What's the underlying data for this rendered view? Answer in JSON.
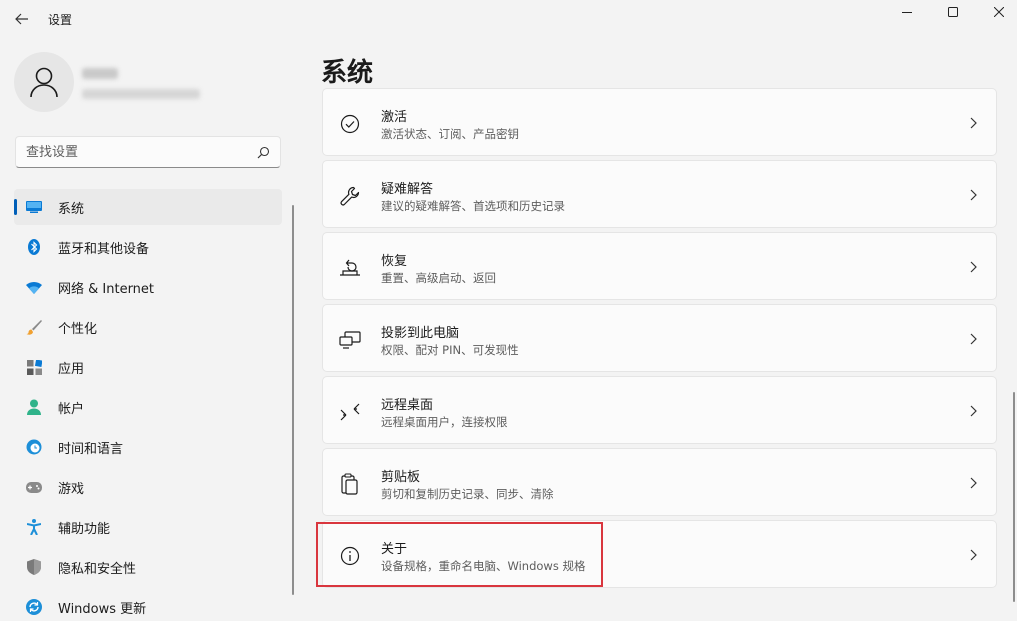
{
  "window": {
    "title": "设置"
  },
  "search": {
    "placeholder": "查找设置"
  },
  "sidebar": {
    "items": [
      {
        "label": "系统",
        "icon": "system-monitor-icon",
        "active": true
      },
      {
        "label": "蓝牙和其他设备",
        "icon": "bluetooth-icon"
      },
      {
        "label": "网络 & Internet",
        "icon": "wifi-icon"
      },
      {
        "label": "个性化",
        "icon": "paintbrush-icon"
      },
      {
        "label": "应用",
        "icon": "apps-icon"
      },
      {
        "label": "帐户",
        "icon": "account-icon"
      },
      {
        "label": "时间和语言",
        "icon": "time-language-icon"
      },
      {
        "label": "游戏",
        "icon": "gamepad-icon"
      },
      {
        "label": "辅助功能",
        "icon": "accessibility-icon"
      },
      {
        "label": "隐私和安全性",
        "icon": "shield-icon"
      },
      {
        "label": "Windows 更新",
        "icon": "windows-update-icon"
      }
    ]
  },
  "main": {
    "title": "系统",
    "cards": [
      {
        "title": "激活",
        "subtitle": "激活状态、订阅、产品密钥",
        "icon": "check-circle-icon"
      },
      {
        "title": "疑难解答",
        "subtitle": "建议的疑难解答、首选项和历史记录",
        "icon": "wrench-icon"
      },
      {
        "title": "恢复",
        "subtitle": "重置、高级启动、返回",
        "icon": "recovery-icon"
      },
      {
        "title": "投影到此电脑",
        "subtitle": "权限、配对 PIN、可发现性",
        "icon": "project-icon"
      },
      {
        "title": "远程桌面",
        "subtitle": "远程桌面用户，连接权限",
        "icon": "remote-desktop-icon"
      },
      {
        "title": "剪贴板",
        "subtitle": "剪切和复制历史记录、同步、清除",
        "icon": "clipboard-icon"
      },
      {
        "title": "关于",
        "subtitle": "设备规格，重命名电脑、Windows 规格",
        "icon": "info-icon"
      }
    ]
  },
  "colors": {
    "accent": "#005fb8",
    "highlight": "#d9363e"
  }
}
